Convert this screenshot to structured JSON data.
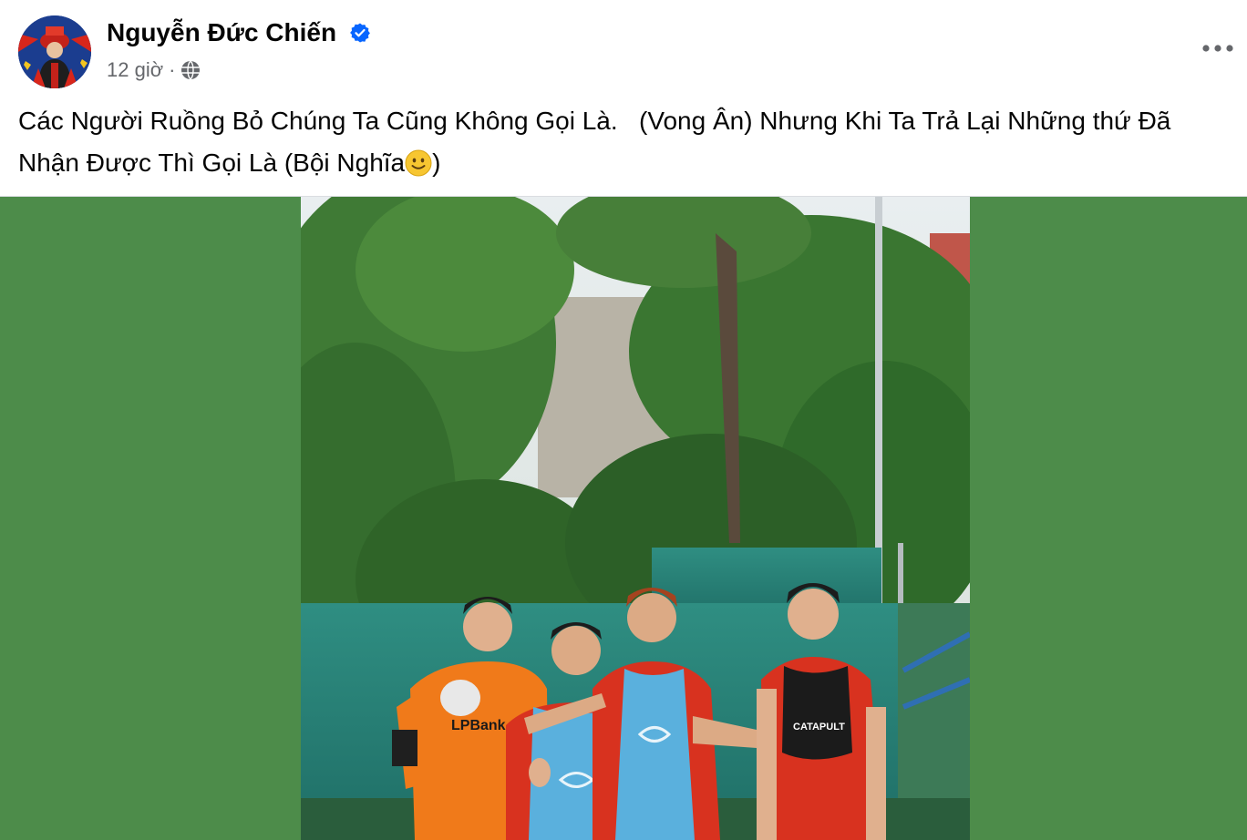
{
  "post": {
    "author": {
      "name": "Nguyễn Đức Chiến",
      "verified": true
    },
    "timestamp": "12 giờ",
    "separator": "·",
    "privacy_icon": "globe-icon",
    "more_icon": "more-horizontal-icon",
    "text": "Các Người Ruồng Bỏ Chúng Ta Cũng Không Gọi Là.   (Vong Ân) Nhưng Khi Ta Trả Lại Những thứ Đã Nhận Được Thì Gọi Là (Bội Nghĩa",
    "text_end": ")",
    "emoji_icon": "slightly-smiling-face-icon"
  },
  "photo": {
    "jersey_text": "LPBank",
    "vest_text": "CATAPULT"
  },
  "colors": {
    "media_background": "#4d8c4a",
    "verified_blue": "#0866ff",
    "meta_gray": "#65676b"
  }
}
